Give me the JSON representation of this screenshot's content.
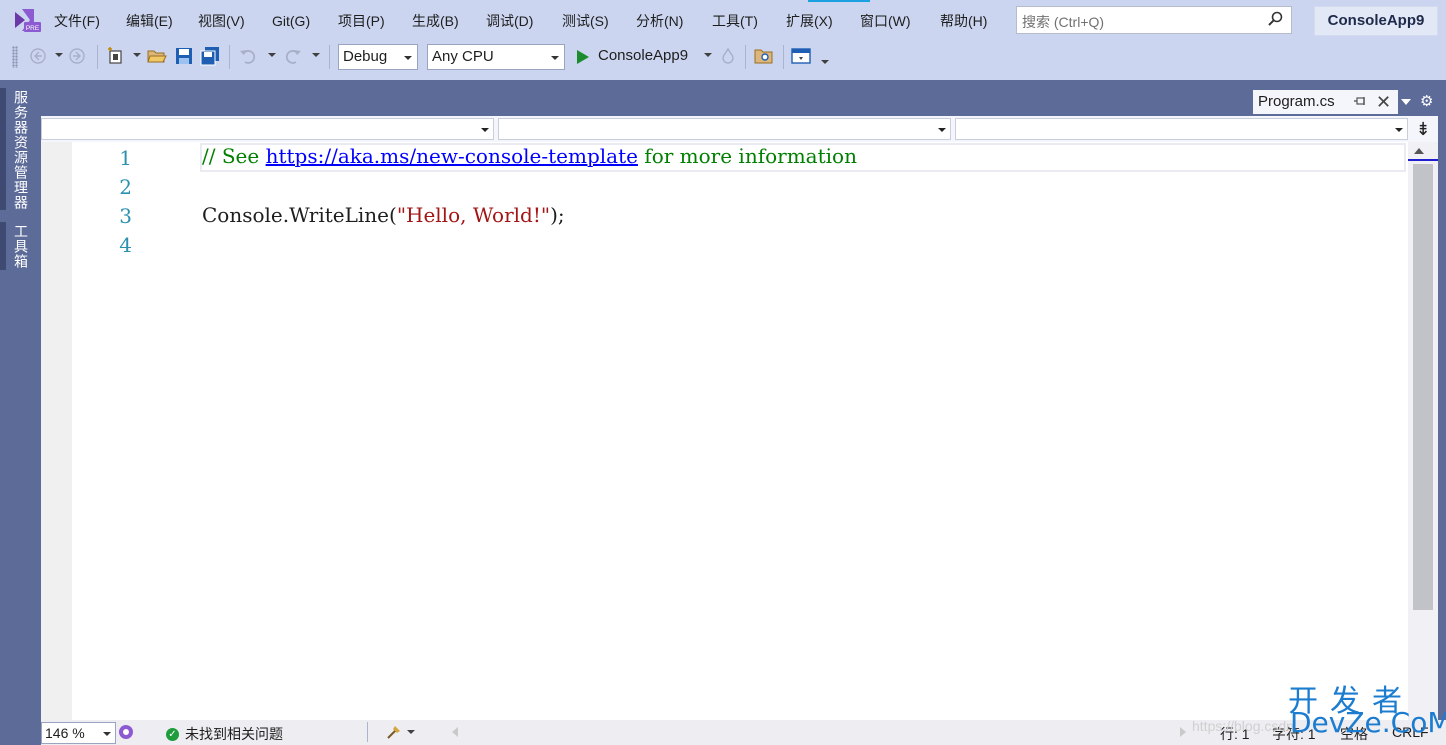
{
  "menubar": {
    "items": [
      "文件(F)",
      "编辑(E)",
      "视图(V)",
      "Git(G)",
      "项目(P)",
      "生成(B)",
      "调试(D)",
      "测试(S)",
      "分析(N)",
      "工具(T)",
      "扩展(X)",
      "窗口(W)",
      "帮助(H)"
    ],
    "logo_badge": "PRE",
    "search_placeholder": "搜索 (Ctrl+Q)",
    "solution_name": "ConsoleApp9"
  },
  "toolbar": {
    "configuration": "Debug",
    "platform": "Any CPU",
    "run_target": "ConsoleApp9"
  },
  "side_tabs": [
    "服务器资源管理器",
    "工具箱"
  ],
  "document_tab": {
    "title": "Program.cs"
  },
  "editor": {
    "line_numbers": [
      "1",
      "2",
      "3",
      "4"
    ],
    "line1": {
      "comment_prefix": "// See ",
      "url": "https://aka.ms/new-console-template",
      "comment_suffix": " for more information"
    },
    "line3": {
      "code": "Console.WriteLine(",
      "string": "\"Hello, World!\"",
      "end": ");"
    }
  },
  "statusbar": {
    "zoom": "146 %",
    "issues": "未找到相关问题",
    "line": "行: 1",
    "char": "字符: 1",
    "spaces": "空格",
    "eol": "CRLF"
  },
  "watermark": {
    "cn": "开发者",
    "en": "DevZe.CoM",
    "url": "https://blog.csdn..."
  },
  "colors": {
    "chrome": "#ccd5f0",
    "frame": "#5d6b99",
    "comment": "#008000",
    "string": "#a31515",
    "line_number": "#2b91af",
    "link": "#0000ff"
  }
}
